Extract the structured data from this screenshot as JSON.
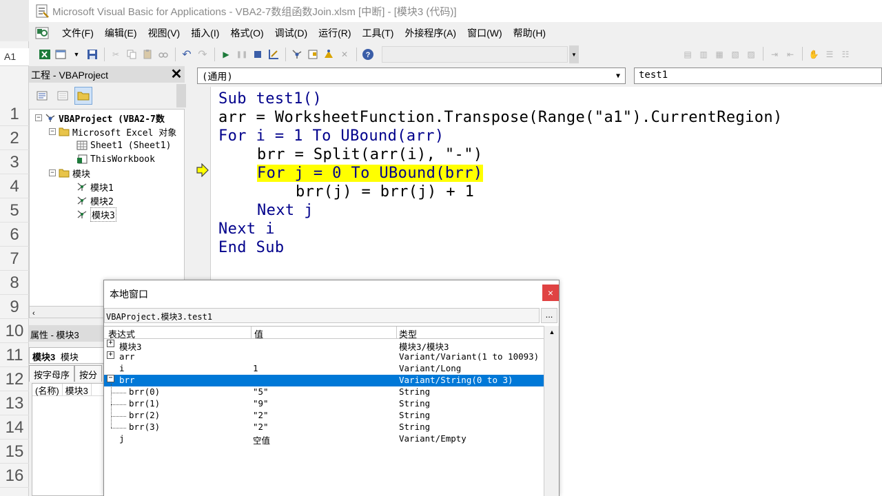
{
  "excel": {
    "name_box": "A1",
    "row_numbers": [
      "1",
      "2",
      "3",
      "4",
      "5",
      "6",
      "7",
      "8",
      "9",
      "10",
      "11",
      "12",
      "13",
      "14",
      "15",
      "16"
    ]
  },
  "window": {
    "title": "Microsoft Visual Basic for Applications - VBA2-7数组函数Join.xlsm [中断] - [模块3 (代码)]"
  },
  "menu": [
    "文件(F)",
    "编辑(E)",
    "视图(V)",
    "插入(I)",
    "格式(O)",
    "调试(D)",
    "运行(R)",
    "工具(T)",
    "外接程序(A)",
    "窗口(W)",
    "帮助(H)"
  ],
  "project": {
    "title": "工程 - VBAProject",
    "close": "✕",
    "tree": [
      {
        "label": "VBAProject (VBA2-7数",
        "toggle": "−",
        "level": 0
      },
      {
        "label": "Microsoft Excel 对象",
        "toggle": "−",
        "level": 1
      },
      {
        "label": "Sheet1 (Sheet1)",
        "toggle": "",
        "level": 2
      },
      {
        "label": "ThisWorkbook",
        "toggle": "",
        "level": 2
      },
      {
        "label": "模块",
        "toggle": "−",
        "level": 1
      },
      {
        "label": "模块1",
        "toggle": "",
        "level": 2
      },
      {
        "label": "模块2",
        "toggle": "",
        "level": 2
      },
      {
        "label": "模块3",
        "toggle": "",
        "level": 2
      }
    ]
  },
  "properties": {
    "title": "属性 - 模块3",
    "object_name": "模块3",
    "object_type": "模块",
    "tab_alpha": "按字母序",
    "tab_category": "按分",
    "prop_name": "(名称)",
    "prop_value": "模块3"
  },
  "code": {
    "object_combo": "(通用)",
    "proc_combo": "test1",
    "lines": [
      {
        "text": "Sub test1()",
        "kw": "Sub",
        "rest": " test1()",
        "indent": 0
      },
      {
        "text": "arr = WorksheetFunction.Transpose(Range(\"a1\").CurrentRegion)",
        "kw": "",
        "rest": "arr = WorksheetFunction.Transpose(Range(\"a1\").CurrentRegion)",
        "indent": 0
      },
      {
        "text": "For i = 1 To UBound(arr)",
        "kw": "For",
        "rest": " i = 1 To UBound(arr)",
        "indent": 0
      },
      {
        "text": "brr = Split(arr(i), \"-\")",
        "kw": "",
        "rest": "brr = Split(arr(i), \"-\")",
        "indent": 1
      },
      {
        "text": "For j = 0 To UBound(brr)",
        "kw": "For",
        "rest": " j = 0 To UBound(brr)",
        "indent": 1,
        "highlight": true
      },
      {
        "text": "brr(j) = brr(j) + 1",
        "kw": "",
        "rest": "brr(j) = brr(j) + 1",
        "indent": 2
      },
      {
        "text": "Next j",
        "kw": "Next",
        "rest": " j",
        "indent": 1
      },
      {
        "text": "Next i",
        "kw": "Next",
        "rest": " i",
        "indent": 0
      },
      {
        "text": "End Sub",
        "kw": "End Sub",
        "rest": "",
        "indent": 0
      }
    ]
  },
  "locals": {
    "title": "本地窗口",
    "close": "×",
    "context": "VBAProject.模块3.test1",
    "dots": "...",
    "headers": {
      "expr": "表达式",
      "value": "值",
      "type": "类型"
    },
    "rows": [
      {
        "expr": "模块3",
        "value": "",
        "type": "模块3/模块3",
        "toggle": "+",
        "level": 0
      },
      {
        "expr": "arr",
        "value": "",
        "type": "Variant/Variant(1 to 10093)",
        "toggle": "+",
        "level": 0
      },
      {
        "expr": "i",
        "value": "1",
        "type": "Variant/Long",
        "toggle": "",
        "level": 0
      },
      {
        "expr": "brr",
        "value": "",
        "type": "Variant/String(0 to 3)",
        "toggle": "−",
        "level": 0,
        "selected": true
      },
      {
        "expr": "brr(0)",
        "value": "\"5\"",
        "type": "String",
        "toggle": "",
        "level": 1
      },
      {
        "expr": "brr(1)",
        "value": "\"9\"",
        "type": "String",
        "toggle": "",
        "level": 1
      },
      {
        "expr": "brr(2)",
        "value": "\"2\"",
        "type": "String",
        "toggle": "",
        "level": 1
      },
      {
        "expr": "brr(3)",
        "value": "\"2\"",
        "type": "String",
        "toggle": "",
        "level": 1
      },
      {
        "expr": "j",
        "value": "空值",
        "type": "Variant/Empty",
        "toggle": "",
        "level": 0
      }
    ]
  },
  "colors": {
    "keyword": "#00008b",
    "highlight": "#ffff00",
    "selection": "#0078d7",
    "close_red": "#e04343"
  }
}
